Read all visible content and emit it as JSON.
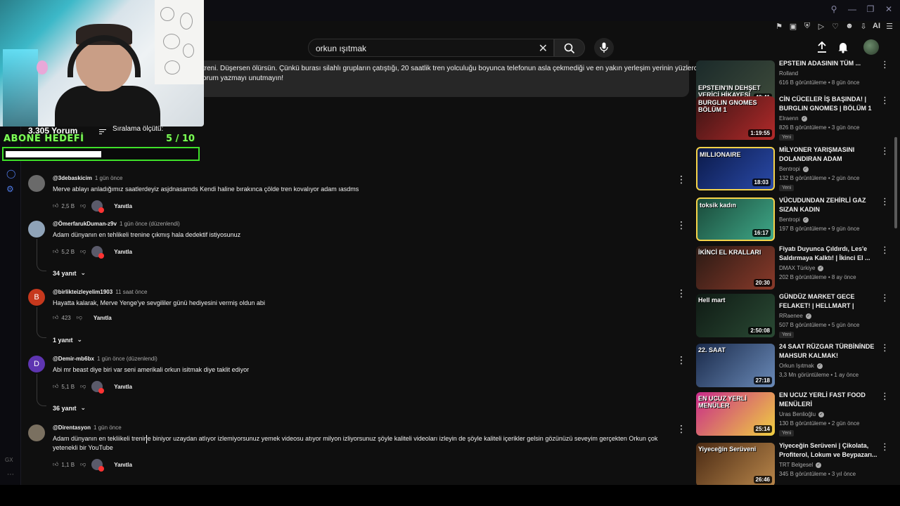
{
  "browser": {
    "extension_ai_label": "AI",
    "sidebar_label": "GX"
  },
  "search": {
    "query": "orkun ışıtmak"
  },
  "description": {
    "line1": "treni. Düşersen ölürsün. Çünkü burası silahlı grupların çatıştığı, 20 saatlik tren yolculuğu boyunca telefonun asla çekmediği ve en yakın yerleşim yerinin yüzlerce",
    "line2": "orum yazmayı unutmayın!"
  },
  "comments_header": {
    "count": "3.305 Yorum",
    "sort_label": "Sıralama ölçütü:"
  },
  "overlay": {
    "goal_title": "ABONE HEDEFİ",
    "goal_current": "5",
    "goal_separator": " / ",
    "goal_target": "10",
    "goal_progress": 0.5
  },
  "comments": [
    {
      "author": "@3debaskicim",
      "time": "1 gün önce",
      "text": "Merve ablayı anladığımız saatlerdeyiz asjdnasamds Kendi haline bırakınca çölde tren kovalıyor adam ıasdms",
      "likes": "2,5 B",
      "reply_label": "Yanıtla",
      "avatar_letter": "",
      "avatar_color": "#6a6a6a"
    },
    {
      "author": "@ÖmerfarukDuman-z9v",
      "time": "1 gün önce (düzenlendi)",
      "text": "Adam dünyanın en tehlikeli trenine çıkmış hala dedektif istiyosunuz",
      "likes": "5,2 B",
      "reply_label": "Yanıtla",
      "avatar_letter": "",
      "avatar_color": "#8fa3b8",
      "replies": "34 yanıt"
    },
    {
      "author": "@birlikteizleyelim1903",
      "time": "11 saat önce",
      "text": "Hayatta kalarak, Merve Yenge'ye sevgililer günü hediyesini vermiş oldun abi",
      "likes": "423",
      "reply_label": "Yanıtla",
      "avatar_letter": "B",
      "avatar_color": "#c6381d",
      "replies": "1 yanıt"
    },
    {
      "author": "@Demir-mb6bx",
      "time": "1 gün önce (düzenlendi)",
      "text": "Abi mr beast diye biri var seni amerikali orkun isitmak diye taklit ediyor",
      "likes": "5,1 B",
      "reply_label": "Yanıtla",
      "avatar_letter": "D",
      "avatar_color": "#5e35b1",
      "replies": "36 yanıt"
    },
    {
      "author": "@Direntasyon",
      "time": "1 gün önce",
      "text": "Adam dünyanın en tekliikeli trenine biniyor uzaydan atlıyor izlemiyorsunuz yemek videosu atıyor milyon izliyorsunuz şöyle kaliteli videoları izleyin de şöyle kaliteli içerikler gelsin gözünüzü seveyim gerçekten Orkun çok yetenekli bir YouTube",
      "likes": "1,1 B",
      "reply_label": "Yanıtla",
      "avatar_letter": "",
      "avatar_color": "#7a7060"
    }
  ],
  "recommendations": [
    {
      "title": "EPSTEIN ADASININ TÜM ...",
      "channel": "Rolland",
      "verified": false,
      "stats": "616 B görüntüleme • 8 gün önce",
      "duration": "40:41",
      "thumb_caption": "EPSTEIN'IN DEHŞET VERİCİ HİKAYESİ",
      "thumb_colors": [
        "#1b2a2a",
        "#3d4a3a"
      ]
    },
    {
      "title": "CİN CÜCELER İŞ BAŞINDA! | BURGLIN GNOMES | BÖLÜM 1",
      "channel": "Elraenn",
      "verified": true,
      "stats": "826 B görüntüleme • 3 gün önce",
      "badge": "Yeni",
      "duration": "1:19:55",
      "thumb_caption": "BURGLIN GNOMES BÖLÜM 1",
      "thumb_colors": [
        "#3a1414",
        "#b32a2a"
      ]
    },
    {
      "title": "MİLYONER YARIŞMASINI DOLANDIRAN ADAM",
      "channel": "Bentropi",
      "verified": true,
      "stats": "132 B görüntüleme • 2 gün önce",
      "badge": "Yeni",
      "duration": "18:03",
      "thumb_caption": "MILLIONAIRE",
      "thumb_colors": [
        "#0b1a4a",
        "#2a4aa8"
      ],
      "highlight": true
    },
    {
      "title": "VÜCUDUNDAN ZEHİRLİ GAZ SIZAN KADIN",
      "channel": "Bentropi",
      "verified": true,
      "stats": "197 B görüntüleme • 9 gün önce",
      "duration": "16:17",
      "thumb_caption": "toksik kadın",
      "thumb_colors": [
        "#1a4a3a",
        "#3fa888"
      ],
      "highlight": true
    },
    {
      "title": "Fiyatı Duyunca Çıldırdı, Les'e Saldırmaya Kalktı! | İkinci El ...",
      "channel": "DMAX Türkiye",
      "verified": true,
      "stats": "202 B görüntüleme • 8 ay önce",
      "duration": "20:30",
      "thumb_caption": "İKİNCİ EL KRALLARI",
      "thumb_colors": [
        "#2a1a14",
        "#8a3a2a"
      ]
    },
    {
      "title": "GÜNDÜZ MARKET GECE FELAKET! | HELLMART |",
      "channel": "RRaenee",
      "verified": true,
      "stats": "507 B görüntüleme • 5 gün önce",
      "badge": "Yeni",
      "duration": "2:50:08",
      "thumb_caption": "Hell mart",
      "thumb_colors": [
        "#0f1a14",
        "#2a4a34"
      ]
    },
    {
      "title": "24 SAAT RÜZGAR TÜRBİNİNDE MAHSUR KALMAK!",
      "channel": "Orkun Işıtmak",
      "verified": true,
      "stats": "3,3 Mn görüntüleme • 1 ay önce",
      "duration": "27:18",
      "thumb_caption": "22. SAAT",
      "thumb_colors": [
        "#1a2a4a",
        "#6a8ab8"
      ]
    },
    {
      "title": "EN UCUZ YERLİ FAST FOOD MENÜLERİ",
      "channel": "Uras Benlioğlu",
      "verified": true,
      "stats": "130 B görüntüleme • 2 gün önce",
      "badge": "Yeni",
      "duration": "25:14",
      "thumb_caption": "EN UCUZ YERLİ MENÜLER",
      "thumb_colors": [
        "#c82a8a",
        "#f0d040"
      ]
    },
    {
      "title": "Yiyeceğin Serüveni | Çikolata, Profiterol, Lokum ve Beypazarı...",
      "channel": "TRT Belgesel",
      "verified": true,
      "stats": "345 B görüntüleme • 3 yıl önce",
      "duration": "26:46",
      "thumb_caption": "Yiyeceğin Serüveni",
      "thumb_colors": [
        "#4a2a14",
        "#b8864a"
      ]
    }
  ]
}
